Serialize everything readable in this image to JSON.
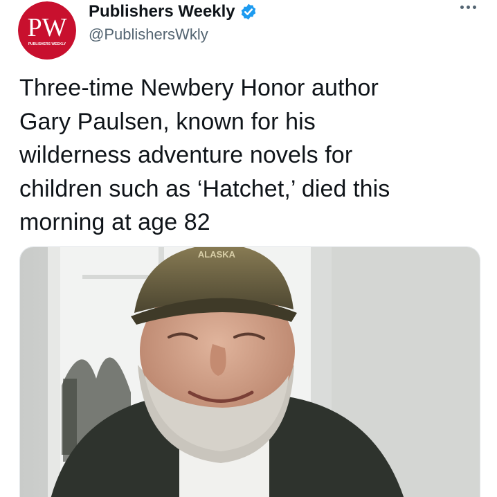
{
  "author": {
    "display_name": "Publishers Weekly",
    "handle": "@PublishersWkly",
    "avatar_logo_text": "PW",
    "avatar_subtext": "PUBLISHERS WEEKLY",
    "verified": true
  },
  "tweet": {
    "text_lines": [
      "Three-time Newbery Honor author",
      "Gary Paulsen, known for his",
      "wilderness adventure novels for",
      "children such as ‘Hatchet,’ died this",
      "morning at age 82"
    ]
  },
  "media": {
    "description": "photo",
    "cap_text": "ALASKA"
  },
  "icons": {
    "verified": "verified-badge-icon",
    "more": "more-options-icon"
  },
  "colors": {
    "brand_red": "#c8102e",
    "verified_blue": "#1d9bf0",
    "text_primary": "#0f1419",
    "text_secondary": "#536471"
  }
}
